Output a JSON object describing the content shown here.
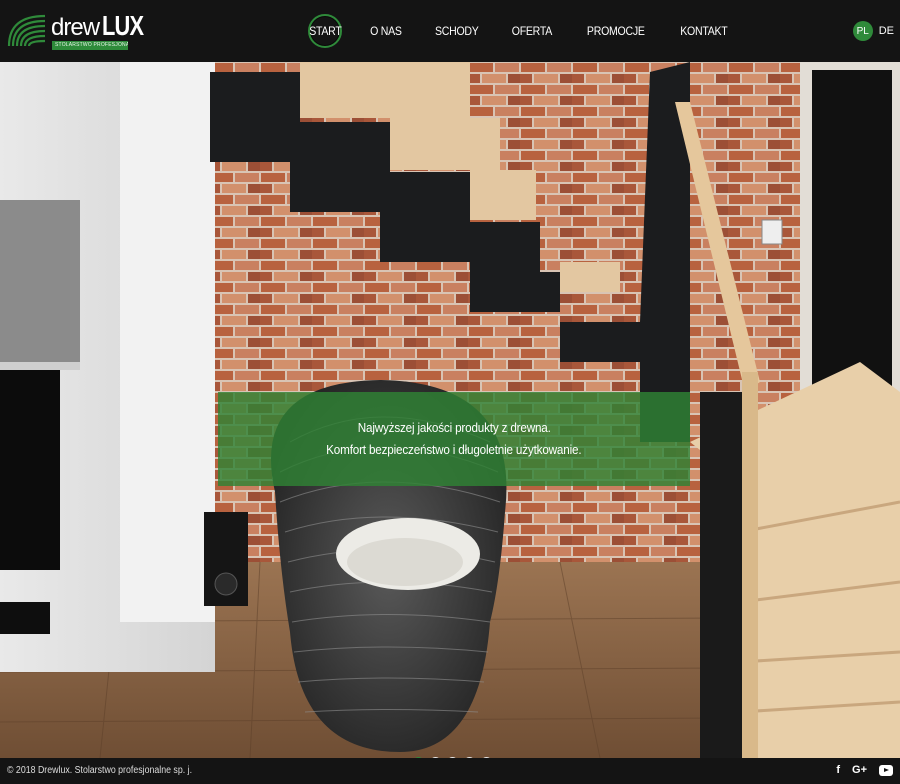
{
  "brand": {
    "name_part1": "drew",
    "name_part2": "LUX",
    "tagline": "STOLARSTWO PROFESJONALNE  SP.J.",
    "accent_color": "#2f8a3a",
    "logo_icon": "wood-rings-icon"
  },
  "nav": {
    "items": [
      {
        "label": "START",
        "active": true
      },
      {
        "label": "O NAS",
        "active": false
      },
      {
        "label": "SCHODY",
        "active": false
      },
      {
        "label": "OFERTA",
        "active": false
      },
      {
        "label": "PROMOCJE",
        "active": false
      },
      {
        "label": "KONTAKT",
        "active": false
      }
    ]
  },
  "lang": {
    "items": [
      {
        "label": "PL",
        "active": true
      },
      {
        "label": "DE",
        "active": false
      }
    ]
  },
  "hero": {
    "image": "staircase-interior-photo",
    "caption_line1": "Najwyższej jakości produkty z drewna.",
    "caption_line2": "Komfort bezpieczeństwo i długoletnie użytkowanie.",
    "slides_total": 5,
    "slide_active": 1
  },
  "footer": {
    "copyright": "© 2018 Drewlux. Stolarstwo profesjonalne sp. j.",
    "social": [
      {
        "icon": "facebook-icon",
        "glyph": "f"
      },
      {
        "icon": "google-plus-icon",
        "glyph": "G+"
      },
      {
        "icon": "youtube-icon",
        "glyph": ""
      }
    ]
  }
}
